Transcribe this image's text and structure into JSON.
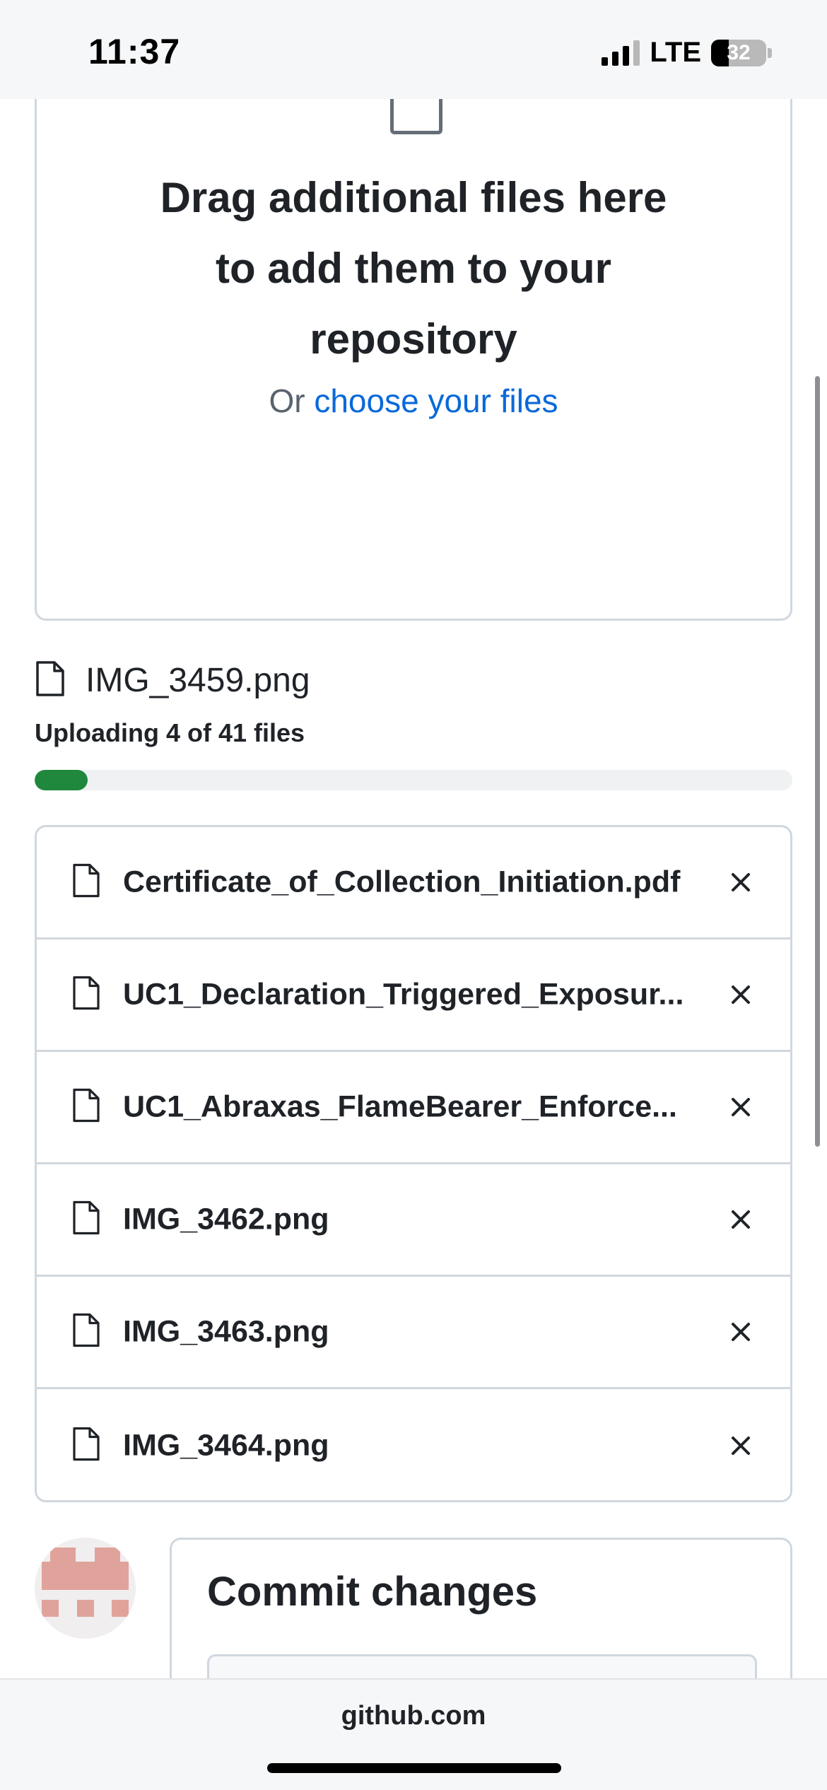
{
  "status_bar": {
    "time": "11:37",
    "network": "LTE",
    "battery": "32"
  },
  "dropzone": {
    "title": "Drag additional files here to add them to your repository",
    "sub_prefix": "Or ",
    "sub_link": "choose your files"
  },
  "upload": {
    "current_file": "IMG_3459.png",
    "status_text": "Uploading 4 of 41 files",
    "progress_fraction": 0.07
  },
  "files": [
    {
      "name": "Certificate_of_Collection_Initiation.pdf"
    },
    {
      "name": "UC1_Declaration_Triggered_Exposur..."
    },
    {
      "name": "UC1_Abraxas_FlameBearer_Enforce..."
    },
    {
      "name": "IMG_3462.png"
    },
    {
      "name": "IMG_3463.png"
    },
    {
      "name": "IMG_3464.png"
    }
  ],
  "commit": {
    "title": "Commit changes"
  },
  "browser": {
    "url": "github.com"
  },
  "colors": {
    "progress": "#1f883d",
    "link": "#0969da",
    "avatar": "#e0a39b"
  }
}
